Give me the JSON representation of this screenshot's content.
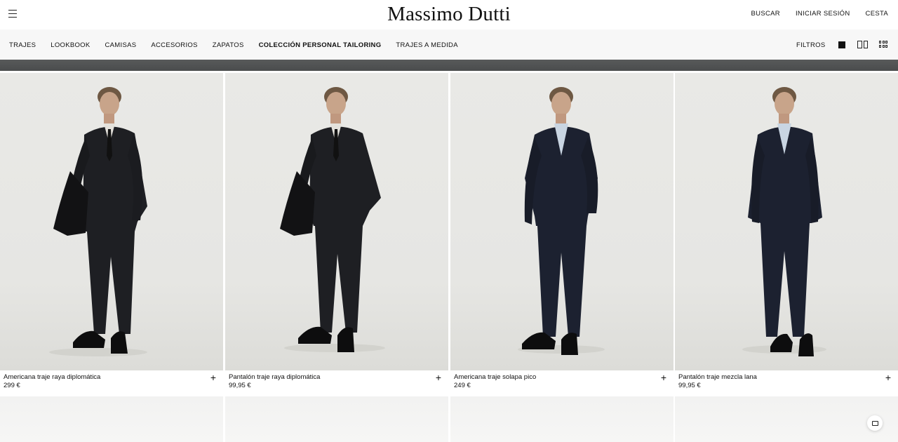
{
  "header": {
    "logo": "Massimo Dutti",
    "actions": [
      "BUSCAR",
      "INICIAR SESIÓN",
      "CESTA"
    ]
  },
  "nav": {
    "items": [
      "TRAJES",
      "LOOKBOOK",
      "CAMISAS",
      "ACCESORIOS",
      "ZAPATOS",
      "COLECCIÓN PERSONAL TAILORING",
      "TRAJES A MEDIDA"
    ],
    "active_item": "COLECCIÓN PERSONAL TAILORING",
    "filters_label": "FILTROS",
    "view_options": [
      "single-view-icon",
      "two-column-view-icon",
      "grid-view-icon"
    ]
  },
  "products": [
    {
      "name": "Americana traje raya diplomática",
      "price": "299 €",
      "add_label": "+"
    },
    {
      "name": "Pantalón traje raya diplomática",
      "price": "99,95 €",
      "add_label": "+"
    },
    {
      "name": "Americana traje solapa pico",
      "price": "249 €",
      "add_label": "+"
    },
    {
      "name": "Pantalón traje mezcla lana",
      "price": "99,95 €",
      "add_label": "+"
    }
  ],
  "colors": {
    "suit_dark": "#1e1f23",
    "suit_navy": "#1c2130",
    "background": "#e8e8e5",
    "banner": "#505253"
  }
}
